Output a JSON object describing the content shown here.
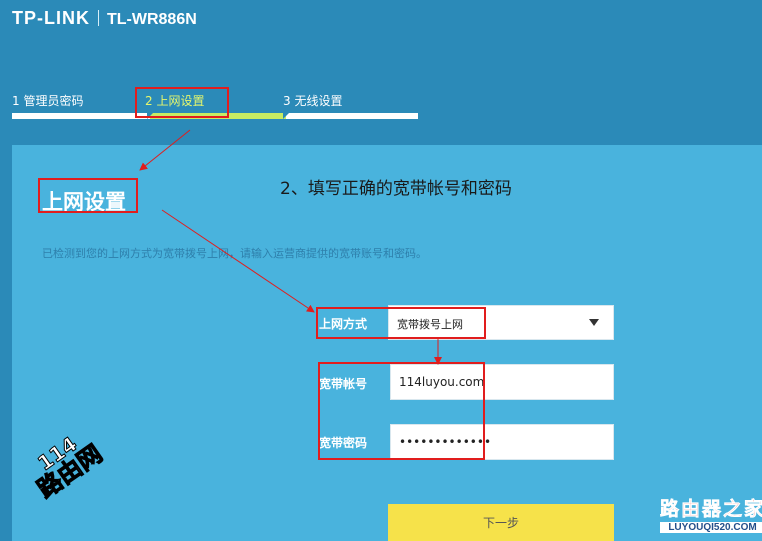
{
  "header": {
    "brand": "TP-LINK",
    "model": "TL-WR886N"
  },
  "steps": [
    {
      "label": "1 管理员密码"
    },
    {
      "label": "2 上网设置"
    },
    {
      "label": "3 无线设置"
    }
  ],
  "panel": {
    "title": "上网设置",
    "instruction": "2、填写正确的宽带帐号和密码",
    "hint": "已检测到您的上网方式为宽带拨号上网，请输入运营商提供的宽带账号和密码。"
  },
  "form": {
    "connection_type": {
      "label": "上网方式",
      "value": "宽带拨号上网"
    },
    "account": {
      "label": "宽带帐号",
      "value": "114luyou.com"
    },
    "password": {
      "label": "宽带密码",
      "value": "•••••••••••••"
    },
    "next_label": "下一步"
  },
  "watermarks": {
    "left_number": "114",
    "left_text": "路由网",
    "right_cn": "路由器之家",
    "right_en": "LUYOUQI520.COM"
  },
  "colors": {
    "header_bg": "#2b8ab8",
    "panel_bg": "#49b3dd",
    "active_step": "#e6f76d",
    "progress_active": "#c8ec63",
    "next_button": "#f6e24a",
    "annotation": "#e11d1d"
  }
}
